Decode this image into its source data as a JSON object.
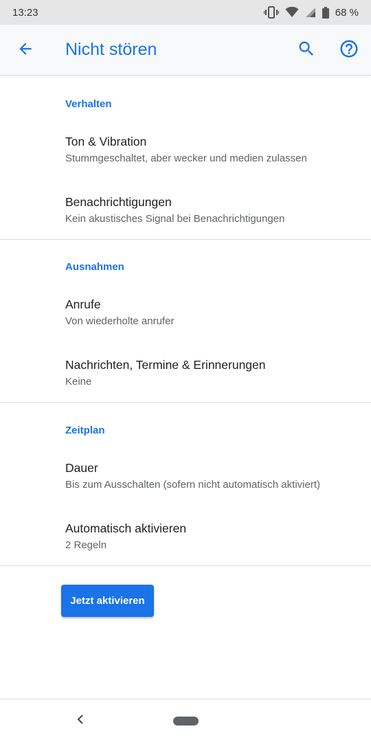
{
  "status_bar": {
    "time": "13:23",
    "battery": "68 %",
    "icons": [
      "vibrate-icon",
      "wifi-icon",
      "cell-signal-icon",
      "battery-icon"
    ]
  },
  "app_bar": {
    "title": "Nicht stören",
    "back_icon": "arrow-back-icon",
    "search_icon": "search-icon",
    "help_icon": "help-icon"
  },
  "sections": [
    {
      "header": "Verhalten",
      "items": [
        {
          "title": "Ton & Vibration",
          "summary": "Stummgeschaltet, aber wecker und medien zulassen"
        },
        {
          "title": "Benachrichtigungen",
          "summary": "Kein akustisches Signal bei Benachrichtigungen"
        }
      ]
    },
    {
      "header": "Ausnahmen",
      "items": [
        {
          "title": "Anrufe",
          "summary": "Von wiederholte anrufer"
        },
        {
          "title": "Nachrichten, Termine & Erinnerungen",
          "summary": "Keine"
        }
      ]
    },
    {
      "header": "Zeitplan",
      "items": [
        {
          "title": "Dauer",
          "summary": "Bis zum Ausschalten (sofern nicht automatisch aktiviert)"
        },
        {
          "title": "Automatisch aktivieren",
          "summary": "2 Regeln"
        }
      ]
    }
  ],
  "actions": {
    "activate_now": "Jetzt aktivieren"
  },
  "colors": {
    "accent": "#1a73e8",
    "primary_text": "#202124",
    "secondary_text": "#5f6368",
    "divider": "#dadce0",
    "status_bar_bg": "#e6e6e6",
    "app_bar_bg": "#f8f9fa"
  }
}
